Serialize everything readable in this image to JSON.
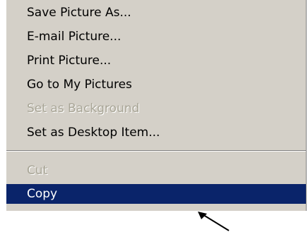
{
  "context_menu": {
    "items": [
      {
        "label": "Save Picture As...",
        "enabled": true
      },
      {
        "label": "E-mail Picture...",
        "enabled": true
      },
      {
        "label": "Print Picture...",
        "enabled": true
      },
      {
        "label": "Go to My Pictures",
        "enabled": true
      },
      {
        "label": "Set as Background",
        "enabled": false
      },
      {
        "label": "Set as Desktop Item...",
        "enabled": true
      }
    ],
    "edit_items": [
      {
        "label": "Cut",
        "enabled": false
      },
      {
        "label": "Copy",
        "enabled": true,
        "selected": true
      }
    ],
    "colors": {
      "menu_background": "#d4d0c8",
      "selection": "#0a246a",
      "disabled_text": "#a8a596"
    }
  },
  "cursor": {
    "icon": "arrow-cursor-icon"
  }
}
